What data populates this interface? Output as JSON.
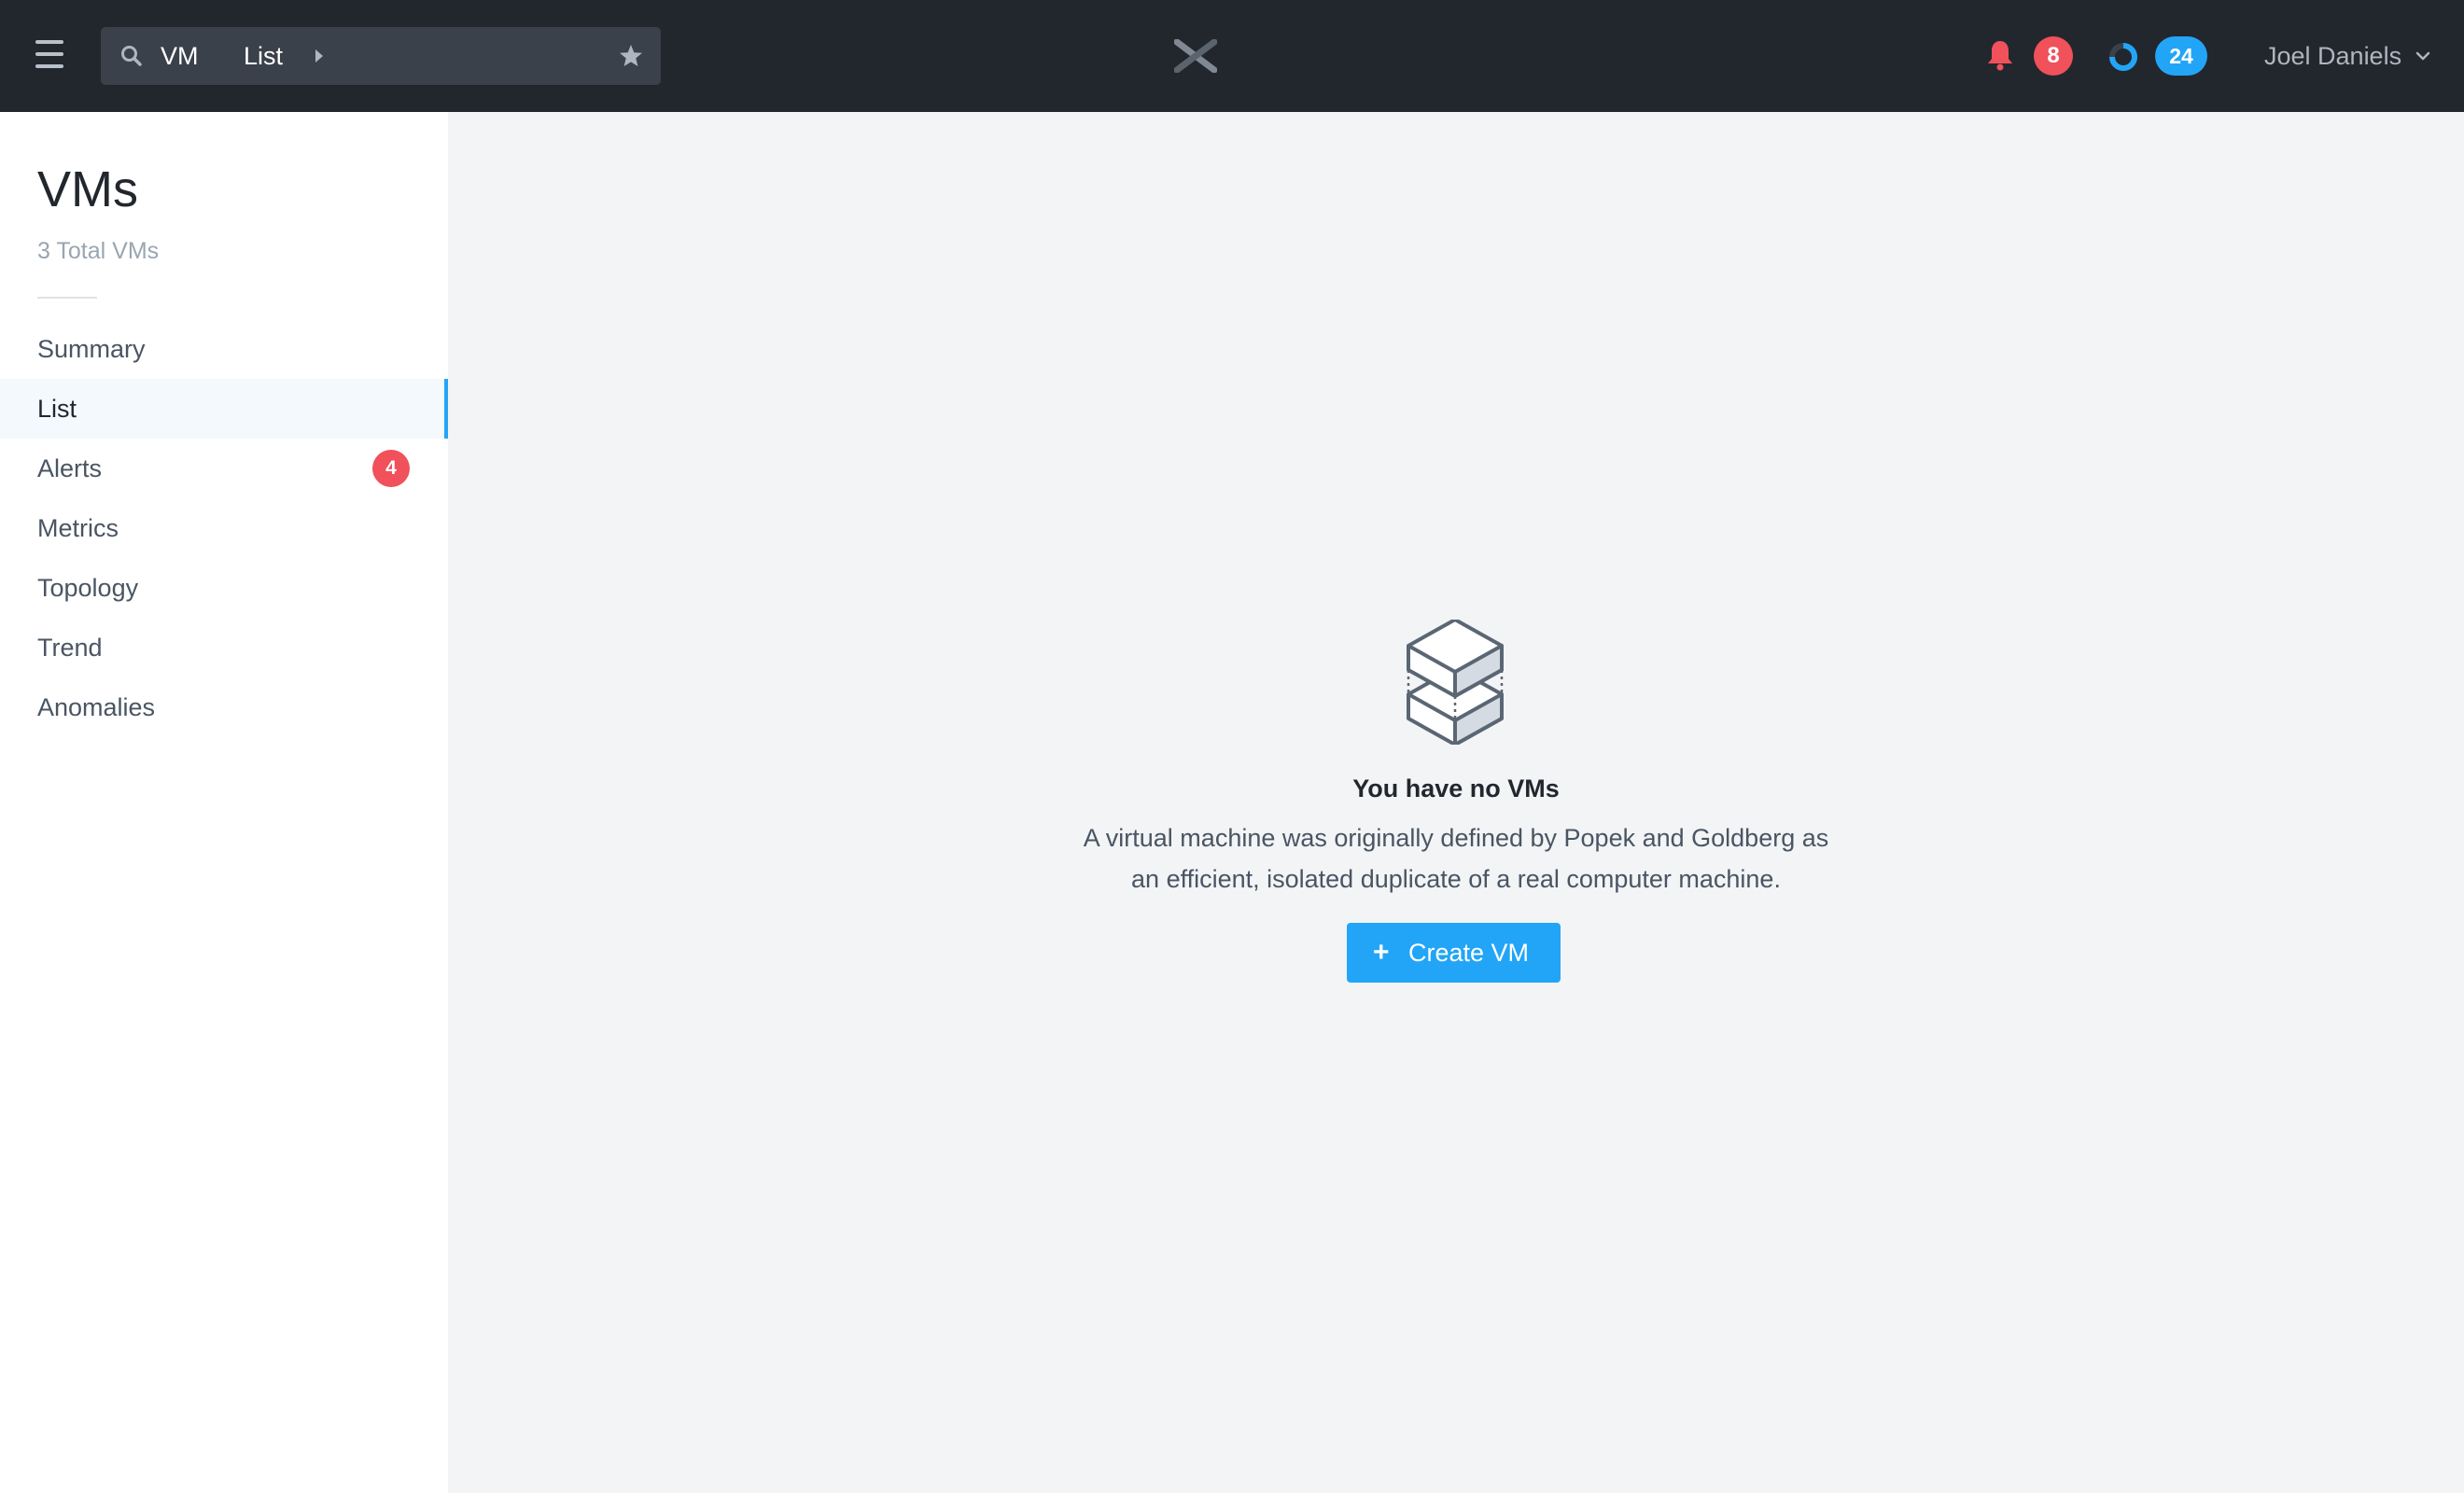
{
  "topbar": {
    "breadcrumb": {
      "first": "VM",
      "second": "List"
    },
    "notifications_count": "8",
    "tasks_count": "24",
    "user_name": "Joel Daniels",
    "colors": {
      "background": "#22272e",
      "alert": "#f0515a",
      "accent": "#22a5f7"
    }
  },
  "sidebar": {
    "title": "VMs",
    "subtitle": "3 Total VMs",
    "items": [
      {
        "label": "Summary",
        "active": false
      },
      {
        "label": "List",
        "active": true
      },
      {
        "label": "Alerts",
        "active": false,
        "badge": "4"
      },
      {
        "label": "Metrics",
        "active": false
      },
      {
        "label": "Topology",
        "active": false
      },
      {
        "label": "Trend",
        "active": false
      },
      {
        "label": "Anomalies",
        "active": false
      }
    ]
  },
  "main": {
    "empty_icon": "stacked-cubes-icon",
    "empty_title": "You have no VMs",
    "empty_desc_line1": "A virtual machine was originally defined by Popek and Goldberg as",
    "empty_desc_line2": "an efficient, isolated duplicate of a real computer machine.",
    "create_button_label": "Create VM"
  }
}
